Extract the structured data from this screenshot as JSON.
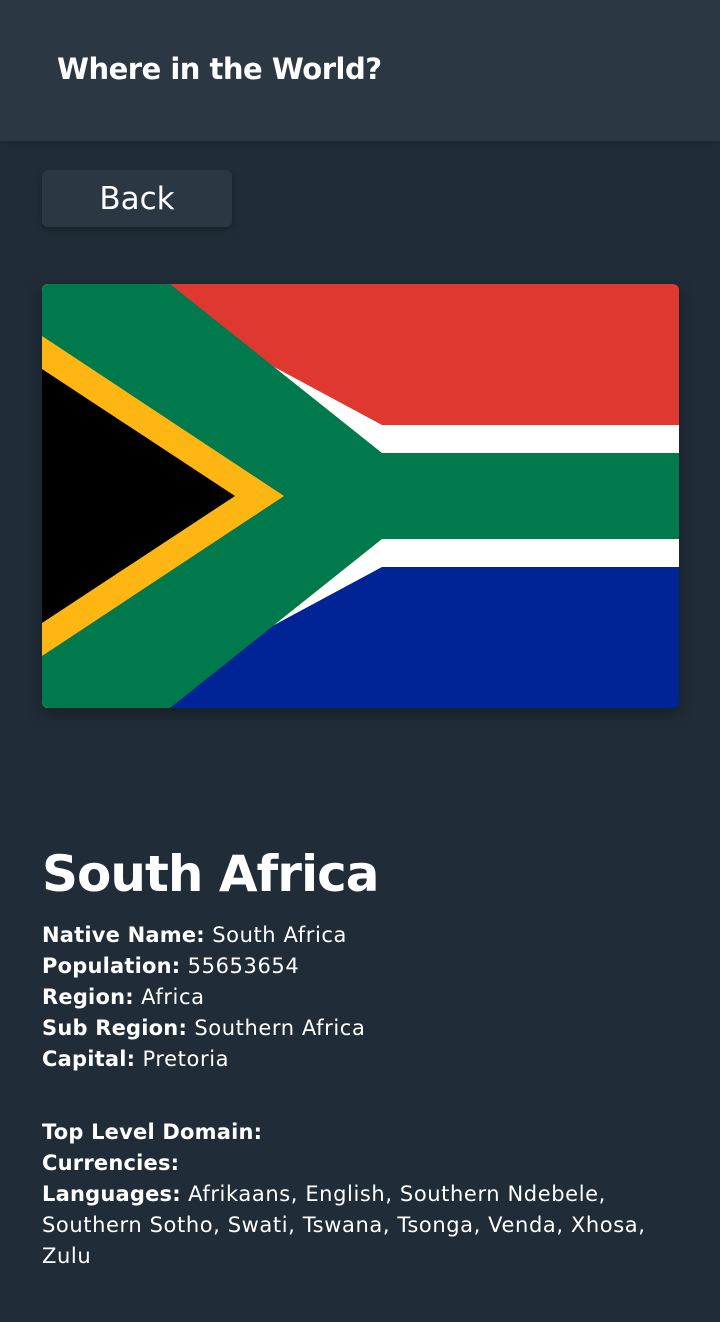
{
  "header": {
    "title": "Where in the World?"
  },
  "back_button": {
    "label": "Back"
  },
  "flag": {
    "icon": "south-africa-flag",
    "colors": {
      "red": "#de3831",
      "white": "#ffffff",
      "green": "#007a4d",
      "blue": "#002395",
      "yellow": "#ffb612",
      "black": "#000000"
    }
  },
  "country": {
    "name": "South Africa",
    "native_name_label": "Native Name:",
    "native_name": "South Africa",
    "population_label": "Population:",
    "population": "55653654",
    "region_label": "Region:",
    "region": "Africa",
    "sub_region_label": "Sub Region:",
    "sub_region": "Southern Africa",
    "capital_label": "Capital:",
    "capital": "Pretoria",
    "tld_label": "Top Level Domain:",
    "tld": "",
    "currencies_label": "Currencies:",
    "currencies": "",
    "languages_label": "Languages:",
    "languages": "Afrikaans, English, Southern Ndebele, Southern Sotho, Swati, Tswana, Tsonga, Venda, Xhosa, Zulu"
  },
  "colors": {
    "background": "#202c37",
    "element": "#2b3844",
    "text": "#ffffff"
  }
}
